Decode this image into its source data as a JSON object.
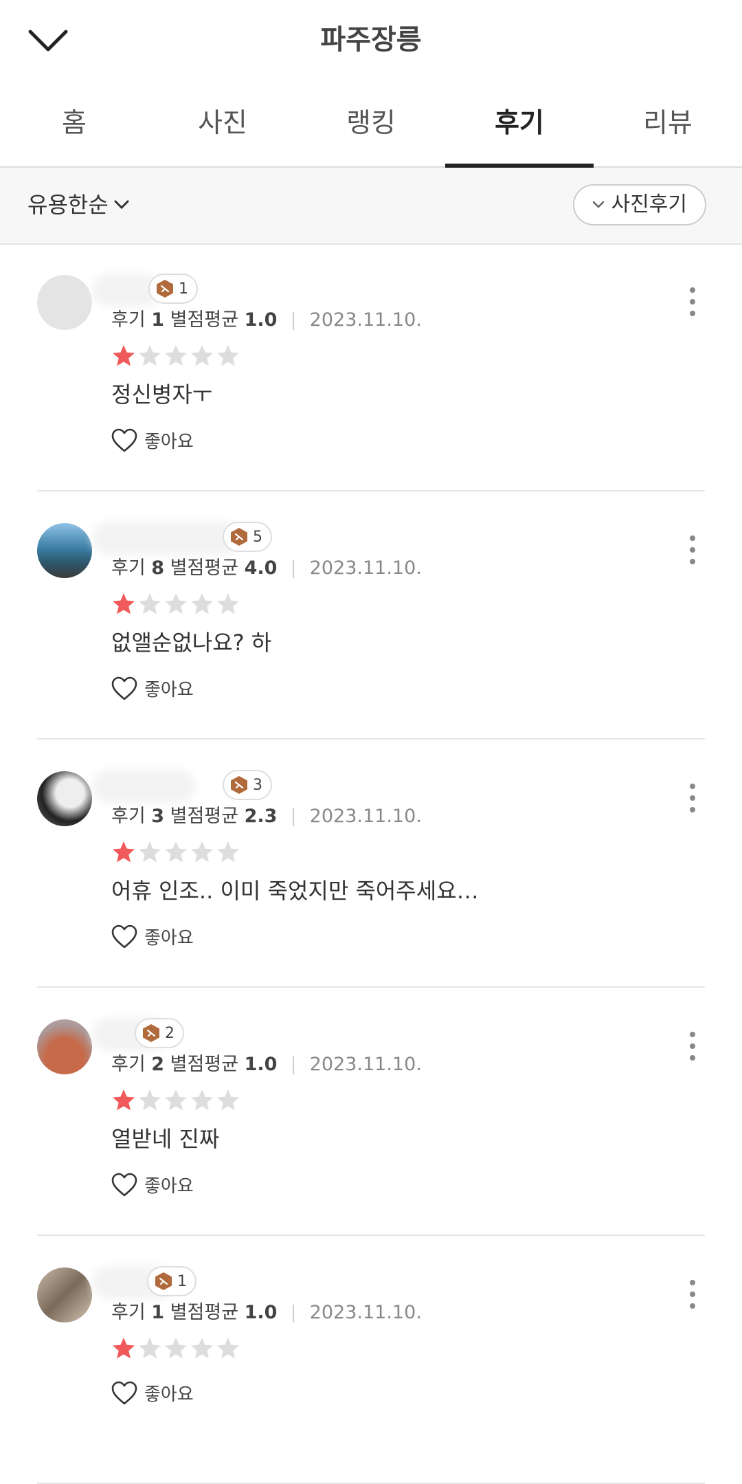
{
  "header": {
    "title": "파주장릉"
  },
  "tabs": [
    {
      "label": "홈",
      "active": false
    },
    {
      "label": "사진",
      "active": false
    },
    {
      "label": "랭킹",
      "active": false
    },
    {
      "label": "후기",
      "active": true
    },
    {
      "label": "리뷰",
      "active": false
    }
  ],
  "filter": {
    "sort_label": "유용한순",
    "photo_filter_label": "사진후기"
  },
  "colors": {
    "star_active": "#f05a5a",
    "star_inactive": "#dddddd",
    "level_badge": "#b06a3c",
    "tab_underline": "#222222"
  },
  "reviews": [
    {
      "level": "1",
      "count_label": "후기",
      "count": "1",
      "rating_label": "별점평균",
      "rating": "1.0",
      "date": "2023.11.10.",
      "stars": 1,
      "text": "정신병자ㅜ",
      "like_label": "좋아요"
    },
    {
      "level": "5",
      "count_label": "후기",
      "count": "8",
      "rating_label": "별점평균",
      "rating": "4.0",
      "date": "2023.11.10.",
      "stars": 1,
      "text": "없앨순없나요? 하",
      "like_label": "좋아요"
    },
    {
      "level": "3",
      "count_label": "후기",
      "count": "3",
      "rating_label": "별점평균",
      "rating": "2.3",
      "date": "2023.11.10.",
      "stars": 1,
      "text": "어휴 인조.. 이미 죽었지만 죽어주세요…",
      "like_label": "좋아요"
    },
    {
      "level": "2",
      "count_label": "후기",
      "count": "2",
      "rating_label": "별점평균",
      "rating": "1.0",
      "date": "2023.11.10.",
      "stars": 1,
      "text": "열받네 진짜",
      "like_label": "좋아요"
    },
    {
      "level": "1",
      "count_label": "후기",
      "count": "1",
      "rating_label": "별점평균",
      "rating": "1.0",
      "date": "2023.11.10.",
      "stars": 1,
      "text": "",
      "like_label": "좋아요"
    }
  ]
}
